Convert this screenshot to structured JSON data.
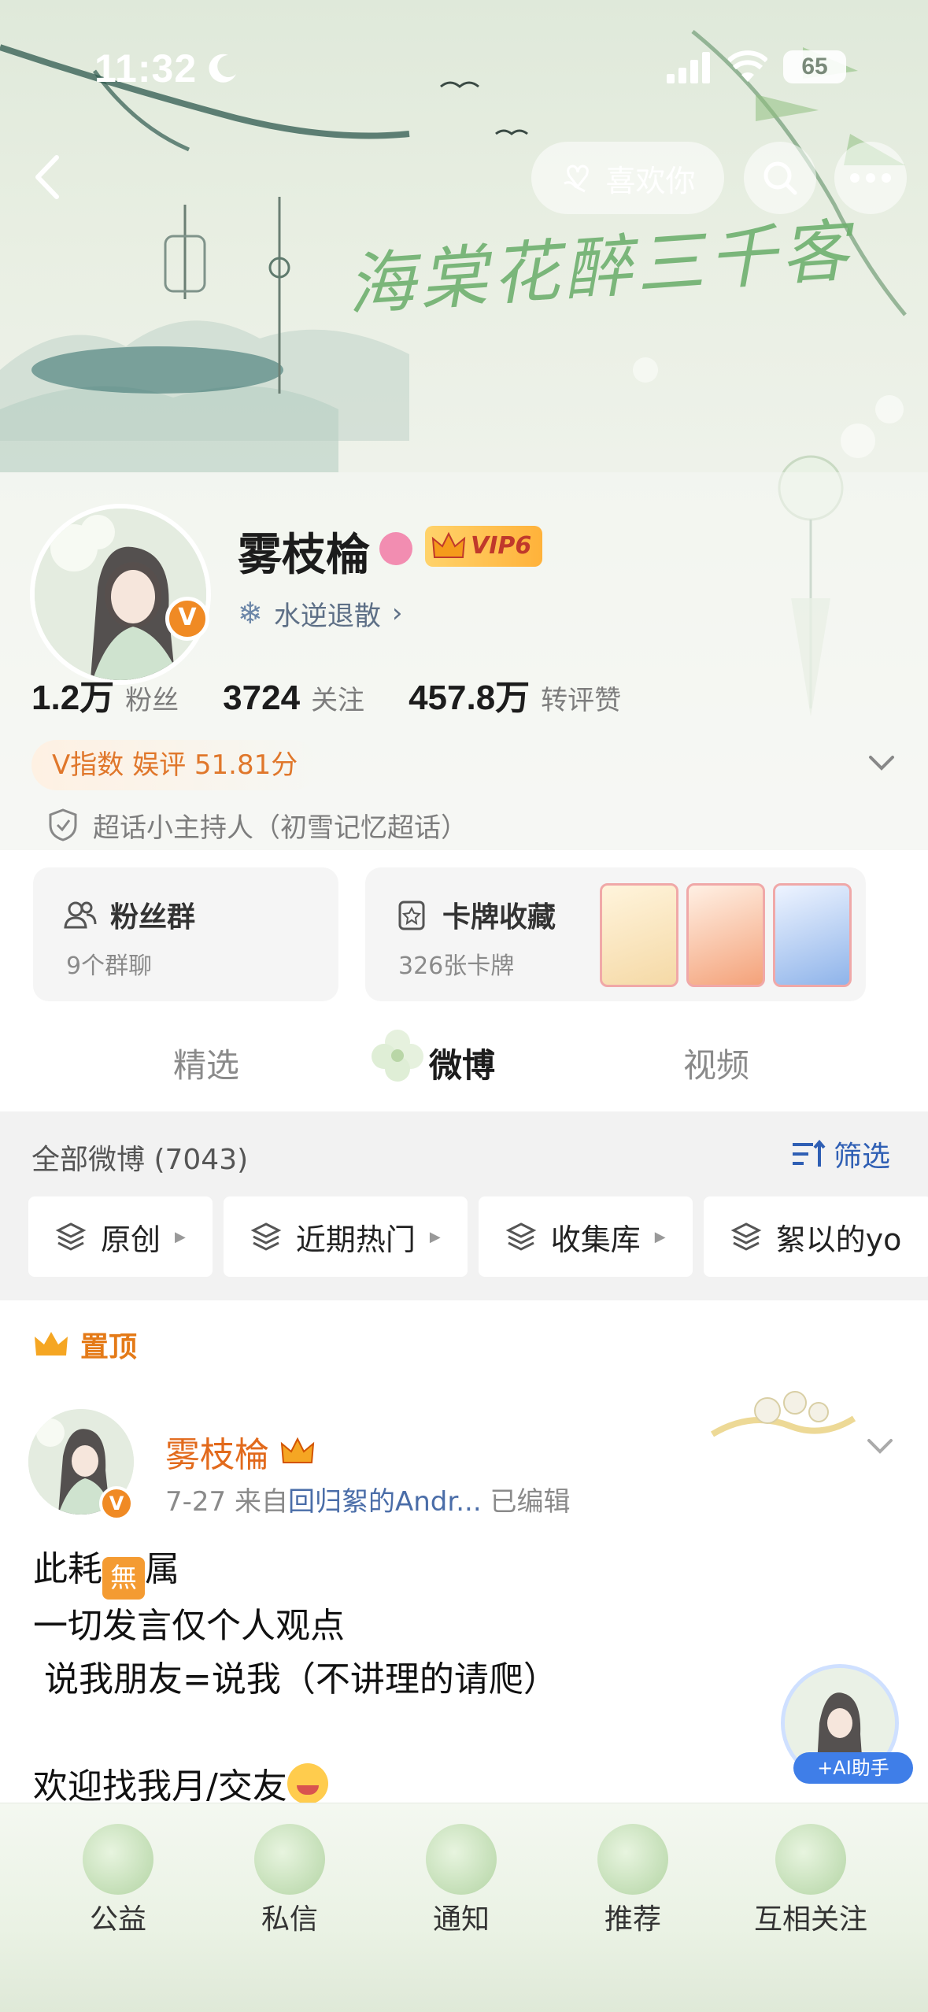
{
  "status": {
    "time": "11:32",
    "battery": "65"
  },
  "header": {
    "like_label": "喜欢你",
    "banner_title": "海棠花醉三千客"
  },
  "profile": {
    "name": "雾枝棆",
    "vip": "VIP6",
    "tagline": "水逆退散",
    "verified": "V",
    "stats": [
      {
        "num": "1.2万",
        "label": "粉丝"
      },
      {
        "num": "3724",
        "label": "关注"
      },
      {
        "num": "457.8万",
        "label": "转评赞"
      }
    ],
    "vindex": "V指数 娱评 51.81分",
    "supertopic": "超话小主持人（初雪记忆超话）"
  },
  "cards": {
    "fans_title": "粉丝群",
    "fans_sub": "9个群聊",
    "cards_title": "卡牌收藏",
    "cards_sub": "326张卡牌"
  },
  "tabs": [
    "精选",
    "微博",
    "视频"
  ],
  "filter": {
    "all": "全部微博 (7043)",
    "filter_label": "筛选",
    "chips": [
      "原创",
      "近期热门",
      "收集库",
      "絮以的yo"
    ]
  },
  "post": {
    "pinned": "置顶",
    "author": "雾枝棆",
    "date": "7-27",
    "from": "来自",
    "source": "回归絮的Andr...",
    "edited": "已编辑",
    "line1_a": "此耗",
    "line1_emoji": "無",
    "line1_b": "属",
    "line2": "一切发言仅个人观点",
    "line3": " 说我朋友=说我（不讲理的请爬）",
    "line5": "欢迎找我月/交友"
  },
  "ai_helper": "+AI助手",
  "nav": [
    "公益",
    "私信",
    "通知",
    "推荐",
    "互相关注"
  ]
}
